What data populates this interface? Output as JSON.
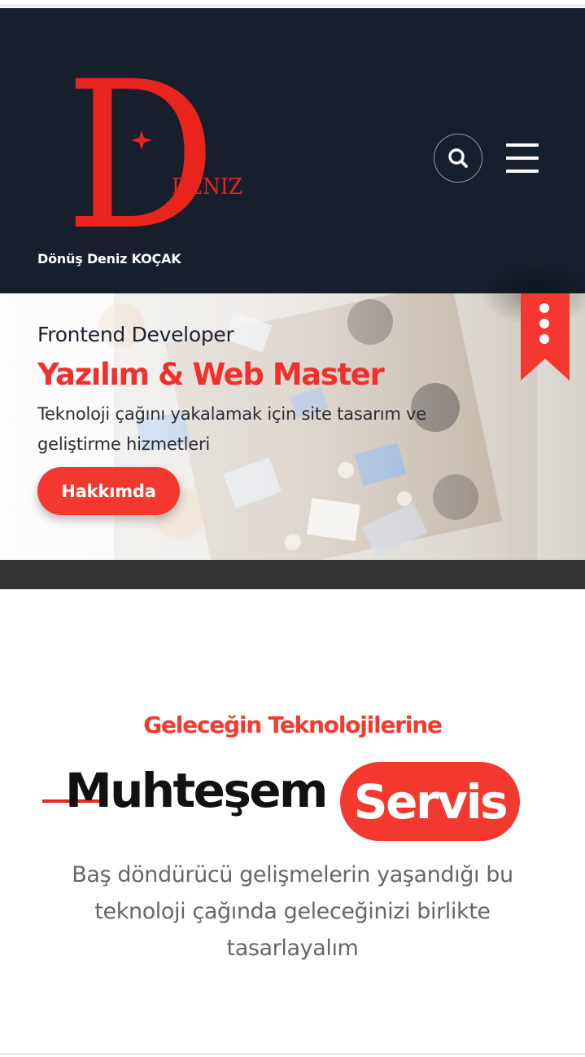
{
  "header": {
    "logo_letter": "D",
    "logo_word": "DENIZ",
    "brand_name": "Dönüş Deniz KOÇAK",
    "search_icon": "search-icon",
    "menu_icon": "hamburger-menu-icon"
  },
  "hero": {
    "pretitle": "Frontend Developer",
    "title": "Yazılım & Web Master",
    "description": "Teknoloji çağını yakalamak için site tasarım ve geliştirme hizmetleri",
    "button_label": "Hakkımda",
    "ribbon_icon": "more-vertical-icon"
  },
  "section": {
    "pretitle": "Geleceğin Teknolojilerine",
    "title": "Muhteşem",
    "highlight": "Servis",
    "description": "Baş döndürücü gelişmelerin yaşandığı bu teknoloji çağında geleceğinizi birlikte tasarlayalım"
  },
  "colors": {
    "header_bg": "#171f2c",
    "accent_red": "#f3392f",
    "dark_strip": "#333333"
  }
}
